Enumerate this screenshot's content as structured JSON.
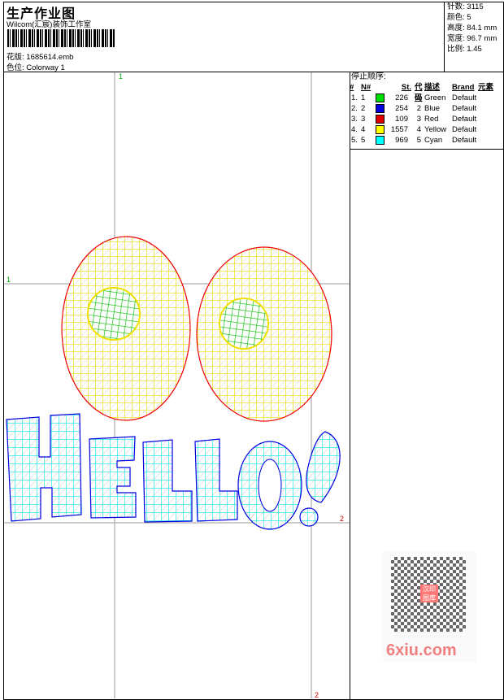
{
  "header": {
    "title": "生产作业图",
    "company": "Wilcom(汇宸)装饰工作室",
    "design_label": "花版:",
    "design_file": "1685614.emb",
    "colorway_label": "色位:",
    "colorway": "Colorway 1"
  },
  "stats": [
    {
      "label": "针数:",
      "value": "3115"
    },
    {
      "label": "颜色:",
      "value": "5"
    },
    {
      "label": "高度:",
      "value": "84.1 mm"
    },
    {
      "label": "宽度:",
      "value": "96.7 mm"
    },
    {
      "label": "比例:",
      "value": "1.45"
    }
  ],
  "stop_sequence": {
    "title": "停止顺序:",
    "columns": [
      "#",
      "N#",
      "St.",
      "代码",
      "描述",
      "Brand",
      "元素"
    ],
    "rows": [
      {
        "idx": "1.",
        "n": "1",
        "color": "#00e000",
        "st": "226",
        "code": "1",
        "desc": "Green",
        "brand": "Default"
      },
      {
        "idx": "2.",
        "n": "2",
        "color": "#0000e0",
        "st": "254",
        "code": "2",
        "desc": "Blue",
        "brand": "Default"
      },
      {
        "idx": "3.",
        "n": "3",
        "color": "#e00000",
        "st": "109",
        "code": "3",
        "desc": "Red",
        "brand": "Default"
      },
      {
        "idx": "4.",
        "n": "4",
        "color": "#ffff00",
        "st": "1557",
        "code": "4",
        "desc": "Yellow",
        "brand": "Default"
      },
      {
        "idx": "5.",
        "n": "5",
        "color": "#00ffff",
        "st": "969",
        "code": "5",
        "desc": "Cyan",
        "brand": "Default"
      }
    ]
  },
  "grid_labels": {
    "v1": "1",
    "v2": "2",
    "h1": "1",
    "h2": "2"
  },
  "watermark": {
    "text": "6xiu.com",
    "seal": "汉印图库"
  }
}
